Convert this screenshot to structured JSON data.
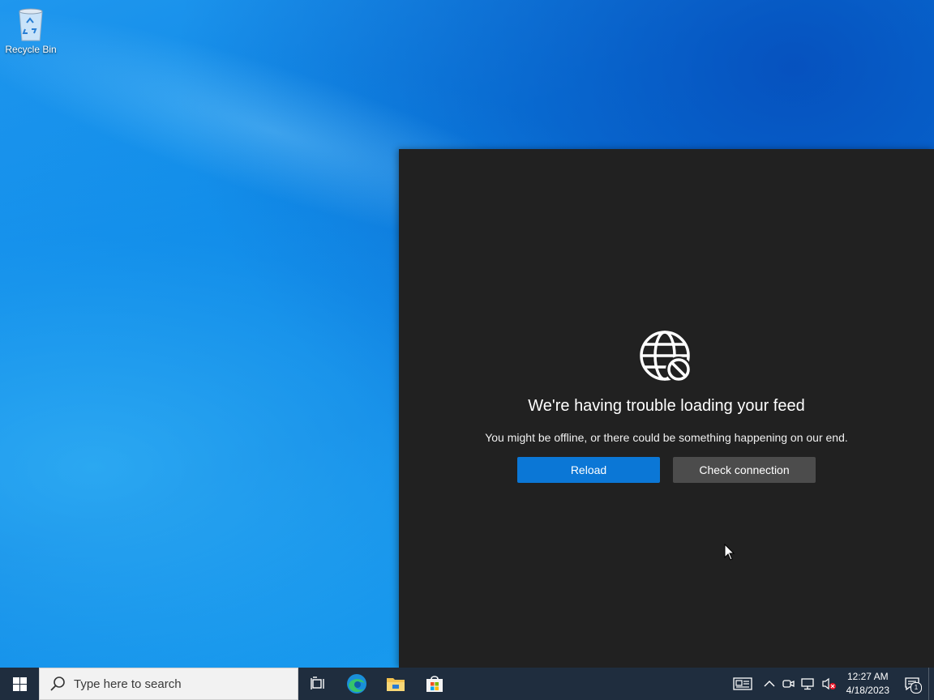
{
  "desktop": {
    "icons": [
      {
        "label": "Recycle Bin",
        "icon": "recycle-bin-icon"
      }
    ]
  },
  "feed_panel": {
    "icon": "globe-blocked-icon",
    "title": "We're having trouble loading your feed",
    "message": "You might be offline, or there could be something happening on our end.",
    "reload_label": "Reload",
    "check_connection_label": "Check connection",
    "colors": {
      "background": "#212121",
      "primary_button": "#0b77d6",
      "secondary_button": "#4c4c4c"
    }
  },
  "taskbar": {
    "search": {
      "placeholder": "Type here to search"
    },
    "pinned": [
      "task-view-icon",
      "edge-icon",
      "file-explorer-icon",
      "store-icon"
    ],
    "tray": {
      "icons": [
        "news-widget-icon",
        "chevron-up-icon",
        "meet-now-icon",
        "network-icon",
        "volume-muted-icon"
      ],
      "time": "12:27 AM",
      "date": "4/18/2023",
      "notification_count": "1"
    },
    "colors": {
      "background": "#1f2d3e"
    }
  }
}
